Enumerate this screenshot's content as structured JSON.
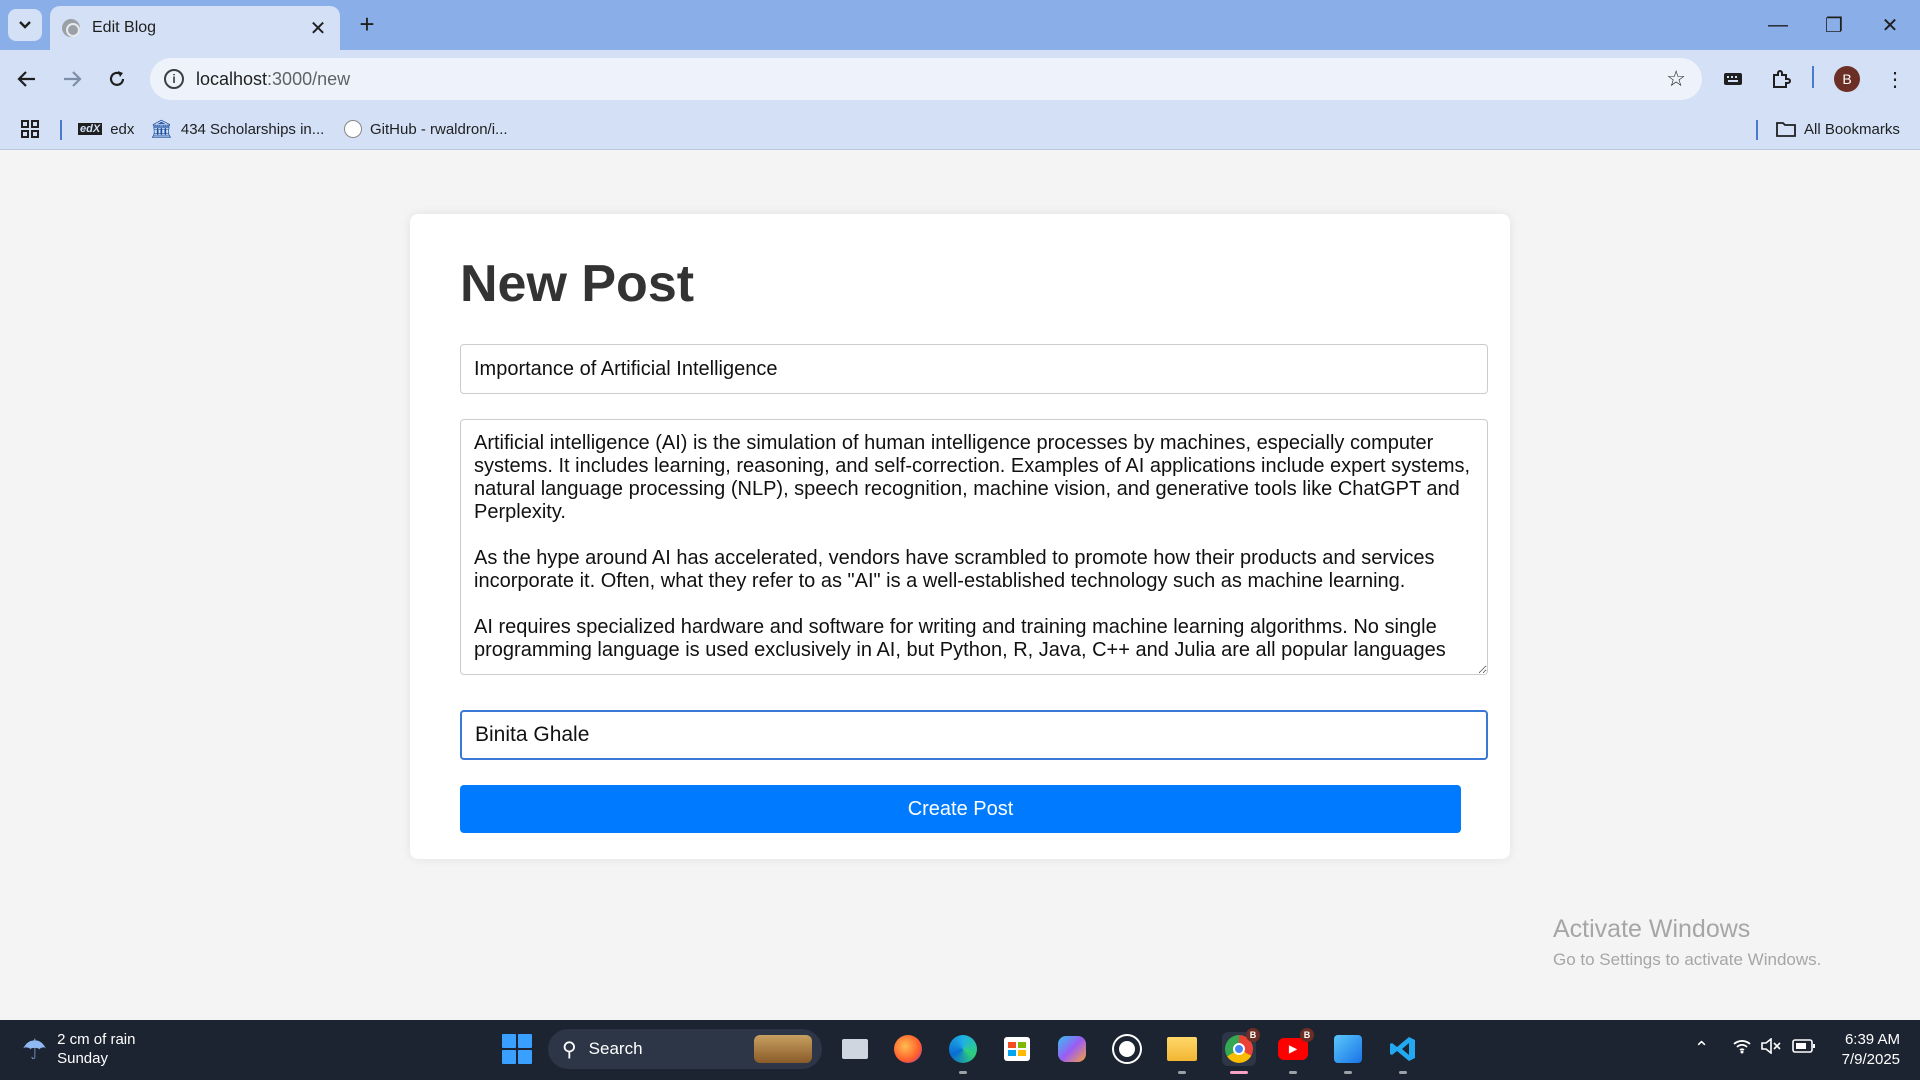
{
  "browser": {
    "tab_title": "Edit Blog",
    "url_host": "localhost",
    "url_path": ":3000/new",
    "profile_initial": "B",
    "bookmarks": [
      {
        "label": "edx"
      },
      {
        "label": "434 Scholarships in..."
      },
      {
        "label": "GitHub - rwaldron/i..."
      }
    ],
    "all_bookmarks_label": "All Bookmarks"
  },
  "form": {
    "heading": "New Post",
    "title_value": "Importance of Artificial Intelligence",
    "content_value": "Artificial intelligence (AI) is the simulation of human intelligence processes by machines, especially computer systems. It includes learning, reasoning, and self-correction. Examples of AI applications include expert systems, natural language processing (NLP), speech recognition, machine vision, and generative tools like ChatGPT and Perplexity.\n\nAs the hype around AI has accelerated, vendors have scrambled to promote how their products and services incorporate it. Often, what they refer to as \"AI\" is a well-established technology such as machine learning.\n\nAI requires specialized hardware and software for writing and training machine learning algorithms. No single programming language is used exclusively in AI, but Python, R, Java, C++ and Julia are all popular languages",
    "author_value": "Binita Ghale",
    "submit_label": "Create Post"
  },
  "watermark": {
    "line1": "Activate Windows",
    "line2": "Go to Settings to activate Windows."
  },
  "taskbar": {
    "weather_line1": "2 cm of rain",
    "weather_line2": "Sunday",
    "search_label": "Search",
    "time": "6:39 AM",
    "date": "7/9/2025",
    "chrome_badge": "B",
    "youtube_badge": "B"
  }
}
